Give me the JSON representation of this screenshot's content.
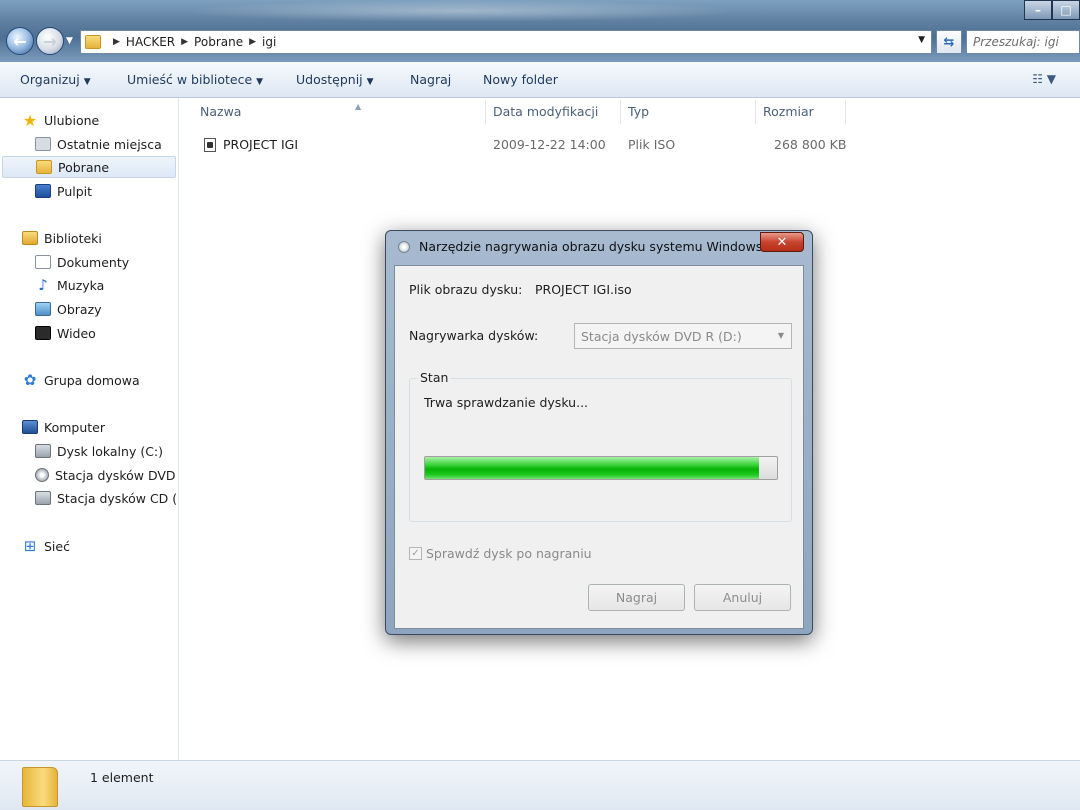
{
  "window": {
    "controls": [
      "–",
      "□"
    ]
  },
  "address": {
    "crumbs": [
      "HACKER",
      "Pobrane",
      "igi"
    ],
    "search_placeholder": "Przeszukaj: igi"
  },
  "toolbar": {
    "organize": "Organizuj",
    "include_library": "Umieść w bibliotece",
    "share": "Udostępnij",
    "burn": "Nagraj",
    "new_folder": "Nowy folder"
  },
  "sidebar": {
    "favorites": "Ulubione",
    "recent": "Ostatnie miejsca",
    "downloads": "Pobrane",
    "desktop": "Pulpit",
    "libraries": "Biblioteki",
    "documents": "Dokumenty",
    "music": "Muzyka",
    "pictures": "Obrazy",
    "videos": "Wideo",
    "homegroup": "Grupa domowa",
    "computer": "Komputer",
    "local_disk": "Dysk lokalny (C:)",
    "dvd_drive": "Stacja dysków DVD R",
    "cd_drive": "Stacja dysków CD (E",
    "network": "Sieć"
  },
  "columns": {
    "name": "Nazwa",
    "modified": "Data modyfikacji",
    "type": "Typ",
    "size": "Rozmiar"
  },
  "files": [
    {
      "name": "PROJECT IGI",
      "modified": "2009-12-22 14:00",
      "type": "Plik ISO",
      "size": "268 800 KB"
    }
  ],
  "status": {
    "count": "1 element"
  },
  "dialog": {
    "title": "Narzędzie nagrywania obrazu dysku systemu Windows",
    "image_label": "Plik obrazu dysku:",
    "image_value": "PROJECT IGI.iso",
    "burner_label": "Nagrywarka dysków:",
    "burner_value": "Stacja dysków DVD R (D:)",
    "status_group": "Stan",
    "status_text": "Trwa sprawdzanie dysku...",
    "progress_percent": 95,
    "verify_label": "Sprawdź dysk po nagraniu",
    "verify_checked": true,
    "burn_button": "Nagraj",
    "cancel_button": "Anuluj"
  },
  "colors": {
    "progress_green": "#06b306",
    "close_red": "#c8442d",
    "link_blue": "#1e395b"
  }
}
